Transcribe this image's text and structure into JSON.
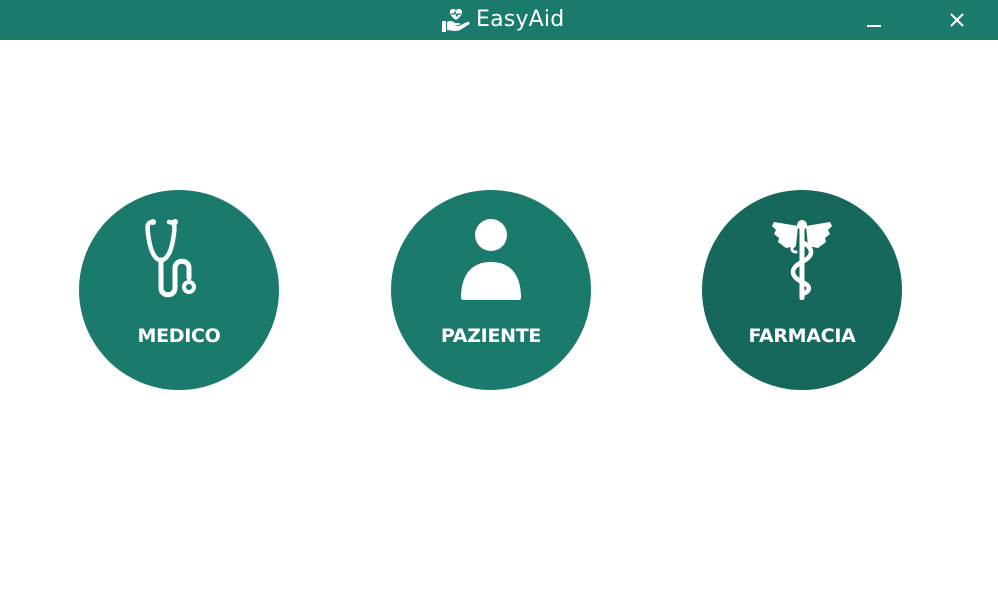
{
  "app": {
    "title": "EasyAid",
    "logo_icon": "hand-heart-icon"
  },
  "window_controls": {
    "minimize_icon": "minimize-icon",
    "close_icon": "close-icon"
  },
  "options": [
    {
      "label": "MEDICO",
      "icon": "stethoscope-icon"
    },
    {
      "label": "PAZIENTE",
      "icon": "user-icon"
    },
    {
      "label": "FARMACIA",
      "icon": "caduceus-icon"
    }
  ],
  "colors": {
    "primary": "#1a7a6b",
    "hover": "#16685c",
    "text": "#ffffff",
    "background": "#ffffff"
  }
}
